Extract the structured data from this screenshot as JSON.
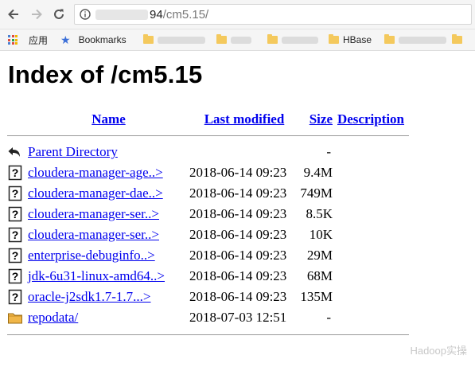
{
  "browser": {
    "url_host_tail": "94",
    "url_path": "/cm5.15/",
    "bookmarks": [
      {
        "label": "应用",
        "icon": "apps-grid-icon"
      },
      {
        "label": "Bookmarks",
        "icon": "star-icon"
      },
      {
        "label": "HBase",
        "icon": "folder-icon"
      }
    ]
  },
  "page": {
    "title": "Index of /cm5.15",
    "columns": {
      "name": "Name",
      "last_modified": "Last modified",
      "size": "Size",
      "description": "Description"
    },
    "rows": [
      {
        "icon": "back-arrow-icon",
        "name": "Parent Directory",
        "modified": "",
        "size": "-"
      },
      {
        "icon": "unknown-file-icon",
        "name": "cloudera-manager-age..>",
        "modified": "2018-06-14 09:23",
        "size": "9.4M"
      },
      {
        "icon": "unknown-file-icon",
        "name": "cloudera-manager-dae..>",
        "modified": "2018-06-14 09:23",
        "size": "749M"
      },
      {
        "icon": "unknown-file-icon",
        "name": "cloudera-manager-ser..>",
        "modified": "2018-06-14 09:23",
        "size": "8.5K"
      },
      {
        "icon": "unknown-file-icon",
        "name": "cloudera-manager-ser..>",
        "modified": "2018-06-14 09:23",
        "size": "10K"
      },
      {
        "icon": "unknown-file-icon",
        "name": "enterprise-debuginfo..>",
        "modified": "2018-06-14 09:23",
        "size": "29M"
      },
      {
        "icon": "unknown-file-icon",
        "name": "jdk-6u31-linux-amd64..>",
        "modified": "2018-06-14 09:23",
        "size": "68M"
      },
      {
        "icon": "unknown-file-icon",
        "name": "oracle-j2sdk1.7-1.7...>",
        "modified": "2018-06-14 09:23",
        "size": "135M"
      },
      {
        "icon": "folder-icon",
        "name": "repodata/",
        "modified": "2018-07-03 12:51",
        "size": "-"
      }
    ]
  },
  "watermark": "Hadoop实操"
}
